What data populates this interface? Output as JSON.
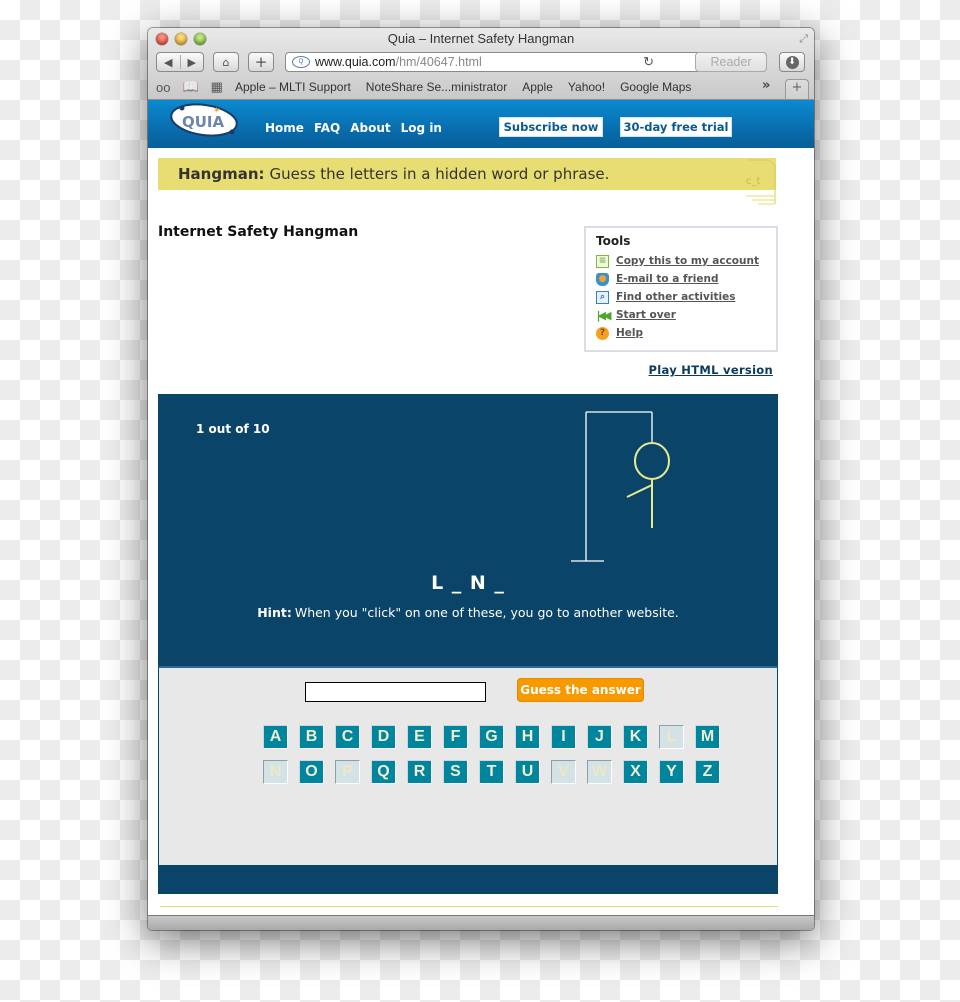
{
  "browser": {
    "window_title": "Quia – Internet Safety Hangman",
    "url_host": "www.quia.com",
    "url_path": "/hm/40647.html",
    "reader_label": "Reader",
    "bookmarks": [
      "Apple – MLTI Support",
      "NoteShare Se...ministrator",
      "Apple",
      "Yahoo!",
      "Google Maps"
    ],
    "more_label": "»",
    "newtab_label": "+"
  },
  "site": {
    "logo_text": "QUIA",
    "nav": [
      "Home",
      "FAQ",
      "About",
      "Log in"
    ],
    "subscribe_label": "Subscribe now",
    "trial_label": "30-day free trial",
    "brand_color": "#0869a9"
  },
  "banner": {
    "label": "Hangman:",
    "text": "Guess the letters in a hidden word or phrase.",
    "icon_text": "c_t"
  },
  "page": {
    "title": "Internet Safety Hangman",
    "play_html_label": "Play HTML version"
  },
  "tools": {
    "title": "Tools",
    "items": [
      {
        "label": "Copy this to my account",
        "icon": "copy-icon"
      },
      {
        "label": "E-mail to a friend",
        "icon": "email-icon"
      },
      {
        "label": "Find other activities",
        "icon": "find-icon"
      },
      {
        "label": "Start over",
        "icon": "start-over-icon"
      },
      {
        "label": "Help",
        "icon": "help-icon"
      }
    ]
  },
  "game": {
    "counter": "1 out of 10",
    "wrong_guesses": 1,
    "max_wrong": 10,
    "word_display": "L _ N _",
    "hint_label": "Hint:",
    "hint_text": "When you \"click\" on one of these, you go to another website.",
    "guess_input_value": "",
    "guess_button_label": "Guess the answer",
    "letters_row1": [
      "A",
      "B",
      "C",
      "D",
      "E",
      "F",
      "G",
      "H",
      "I",
      "J",
      "K",
      "L",
      "M"
    ],
    "letters_row2": [
      "N",
      "O",
      "P",
      "Q",
      "R",
      "S",
      "T",
      "U",
      "V",
      "W",
      "X",
      "Y",
      "Z"
    ],
    "used_letters": [
      "L",
      "N",
      "P",
      "V",
      "W"
    ],
    "stage_color": "#0b4469",
    "key_color": "#00859e",
    "button_color": "#f79a00"
  }
}
